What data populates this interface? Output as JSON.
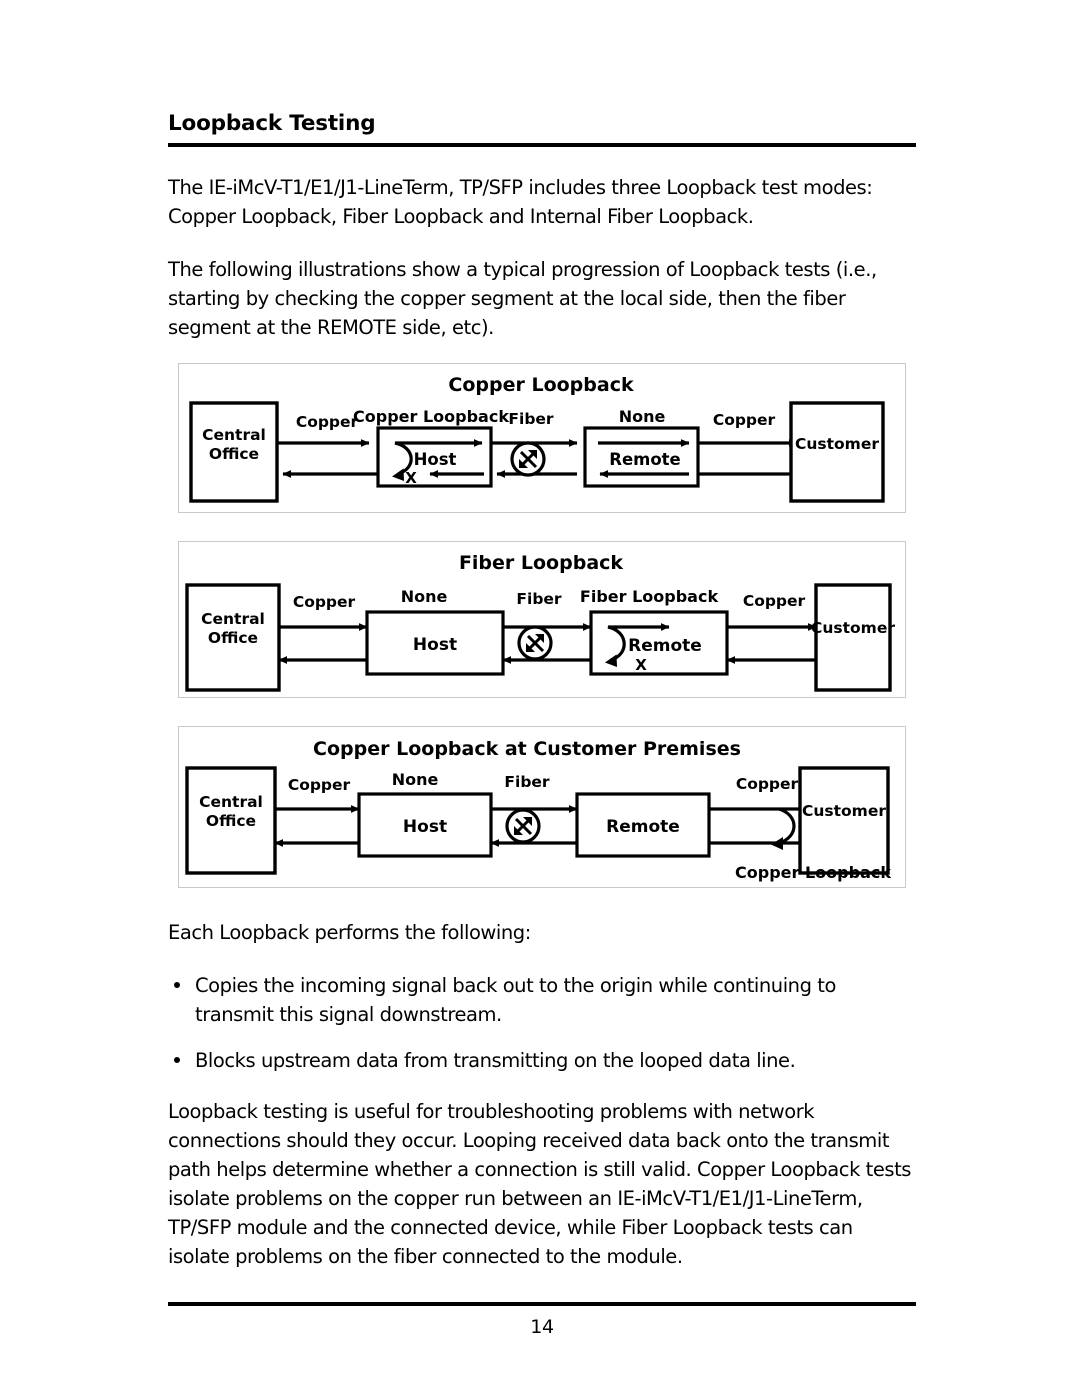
{
  "document": {
    "section_title": "Loopback Testing",
    "page_number": "14",
    "paragraphs": {
      "intro": "The IE-iMcV-T1/E1/J1-LineTerm, TP/SFP includes three Loopback test modes: Copper Loopback, Fiber Loopback and Internal Fiber Loopback.",
      "illustrations": "The following illustrations show a typical progression of Loopback tests (i.e., starting by checking the copper segment at the local side, then the fiber segment at the REMOTE side, etc).",
      "each_loopback": "Each Loopback performs the following:",
      "closing": "Loopback testing is useful for troubleshooting problems with network connections should they occur.  Looping received data back onto the transmit path helps determine whether a connection is still valid.  Copper Loopback tests isolate problems on the copper run between an IE-iMcV-T1/E1/J1-LineTerm, TP/SFP module and the connected device, while Fiber Loopback tests can isolate problems on the fiber connected to the module."
    },
    "bullets": [
      "Copies the incoming signal back out to the origin while continuing to transmit this signal downstream.",
      "Blocks upstream data from transmitting on the looped data line."
    ]
  },
  "figures": [
    {
      "id": "copper-loopback",
      "title": "Copper Loopback",
      "left_node": "Central\nOffice",
      "left_node_line1": "Central",
      "left_node_line2": "Office",
      "right_node": "Customer",
      "host_box": {
        "label": "Host",
        "mode_label": "Copper Loopback",
        "marker": "X",
        "has_loop": true
      },
      "remote_box": {
        "label": "Remote",
        "mode_label": "None",
        "marker": "",
        "has_loop": false
      },
      "link_left": "Copper",
      "link_middle": "Fiber",
      "link_right": "Copper",
      "caption": ""
    },
    {
      "id": "fiber-loopback",
      "title": "Fiber Loopback",
      "left_node_line1": "Central",
      "left_node_line2": "Office",
      "right_node": "Customer",
      "host_box": {
        "label": "Host",
        "mode_label": "None",
        "marker": "",
        "has_loop": false
      },
      "remote_box": {
        "label": "Remote",
        "mode_label": "Fiber Loopback",
        "marker": "X",
        "has_loop": true
      },
      "link_left": "Copper",
      "link_middle": "Fiber",
      "link_right": "Copper",
      "caption": ""
    },
    {
      "id": "copper-loopback-customer-premises",
      "title": "Copper Loopback at Customer Premises",
      "left_node_line1": "Central",
      "left_node_line2": "Office",
      "right_node": "Customer",
      "host_box": {
        "label": "Host",
        "mode_label": "None",
        "marker": "",
        "has_loop": false
      },
      "remote_box": {
        "label": "Remote",
        "mode_label": "",
        "marker": "",
        "has_loop": false
      },
      "link_left": "Copper",
      "link_middle": "Fiber",
      "link_right": "Copper",
      "caption": "Copper Loopback"
    }
  ],
  "icons": {
    "fiber": "fiber-transceiver-icon"
  },
  "colors": {
    "ink": "#000000",
    "frame": "#c9c9c9",
    "paper": "#ffffff"
  }
}
